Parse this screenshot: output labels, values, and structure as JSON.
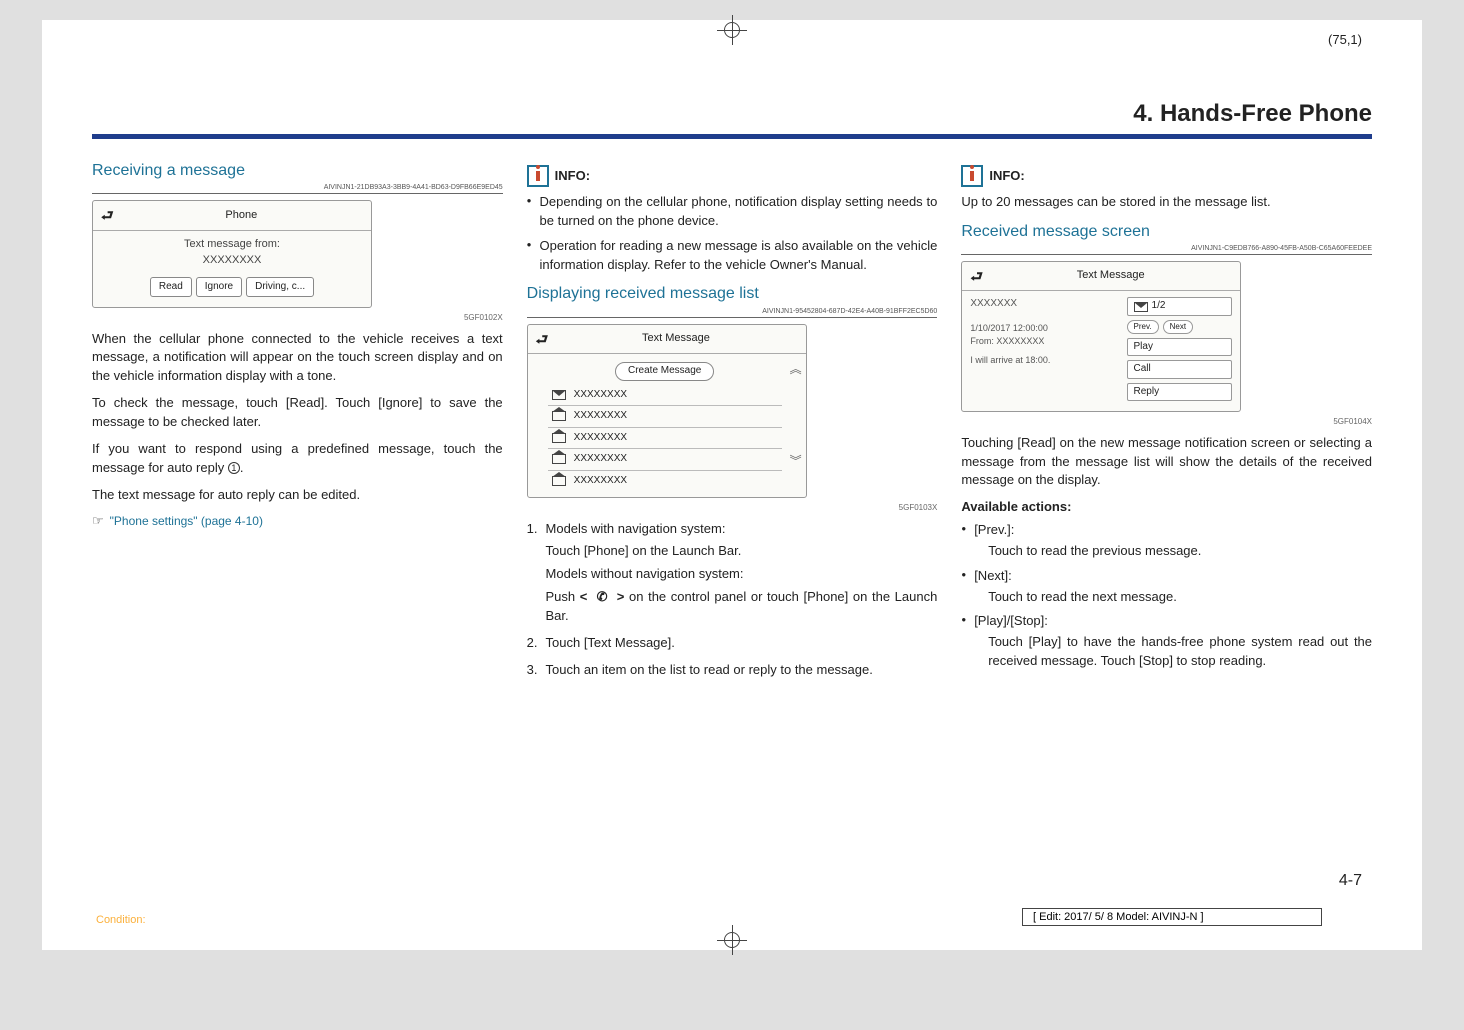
{
  "page_coord": "(75,1)",
  "chapter_title": "4. Hands-Free Phone",
  "col1": {
    "section1_title": "Receiving a message",
    "section1_guid": "AIVINJN1-21DB93A3-3BB9-4A41-BD63-D9FB66E9ED45",
    "ss1": {
      "header": "Phone",
      "line1": "Text message from:",
      "line2": "XXXXXXXX",
      "btn1": "Read",
      "btn2": "Ignore",
      "btn3": "Driving, c..."
    },
    "ss1_ref": "5GF0102X",
    "p1": "When the cellular phone connected to the vehicle receives a text message, a notification will appear on the touch screen display and on the vehicle information display with a tone.",
    "p2": "To check the message, touch [Read]. Touch [Ignore] to save the message to be checked later.",
    "p3_a": "If you want to respond using a predefined message, touch the message for auto reply ",
    "p3_circ": "1",
    "p3_b": ".",
    "p4": "The text message for auto reply can be edited.",
    "link": "\"Phone settings\" (page 4-10)"
  },
  "col2": {
    "info_label": "INFO:",
    "bullet1": "Depending on the cellular phone, notification display setting needs to be turned on the phone device.",
    "bullet2": "Operation for reading a new message is also available on the vehicle information display. Refer to the vehicle Owner's Manual.",
    "section2_title": "Displaying received message list",
    "section2_guid": "AIVINJN1-95452804-687D-42E4-A40B-91BFF2EC5D60",
    "ss2": {
      "header": "Text Message",
      "create": "Create Message",
      "rows": [
        "XXXXXXXX",
        "XXXXXXXX",
        "XXXXXXXX",
        "XXXXXXXX",
        "XXXXXXXX"
      ]
    },
    "ss2_ref": "5GF0103X",
    "ol1_a": "Models with navigation system:",
    "ol1_b": "Touch [Phone] on the Launch Bar.",
    "ol1_c": "Models without navigation system:",
    "ol1_d_a": "Push ",
    "ol1_d_b": " on the control panel or touch [Phone] on the Launch Bar.",
    "ol2": "Touch [Text Message].",
    "ol3": "Touch an item on the list to read or reply to the message."
  },
  "col3": {
    "info_label": "INFO:",
    "p1": "Up to 20 messages can be stored in the message list.",
    "section3_title": "Received message screen",
    "section3_guid": "AIVINJN1-C9EDB766-A890-45FB-A50B-C65A60FEEDEE",
    "ss3": {
      "header": "Text Message",
      "sender": "XXXXXXX",
      "ts": "1/10/2017 12:00:00",
      "from": "From: XXXXXXXX",
      "body": "I will arrive at 18:00.",
      "counter": "1/2",
      "prev": "Prev.",
      "next": "Next",
      "play": "Play",
      "call": "Call",
      "reply": "Reply"
    },
    "ss3_ref": "5GF0104X",
    "p2": "Touching [Read] on the new message notification screen or selecting a message from the message list will show the details of the received message on the display.",
    "avail": "Available actions:",
    "li1_h": "[Prev.]:",
    "li1_b": "Touch to read the previous message.",
    "li2_h": "[Next]:",
    "li2_b": "Touch to read the next message.",
    "li3_h": "[Play]/[Stop]:",
    "li3_b": "Touch [Play] to have the hands-free phone system read out the received message. Touch [Stop] to stop reading."
  },
  "page_number": "4-7",
  "footer_left": "Condition:",
  "footer_right": "[ Edit: 2017/ 5/ 8    Model:  AIVINJ-N ]"
}
